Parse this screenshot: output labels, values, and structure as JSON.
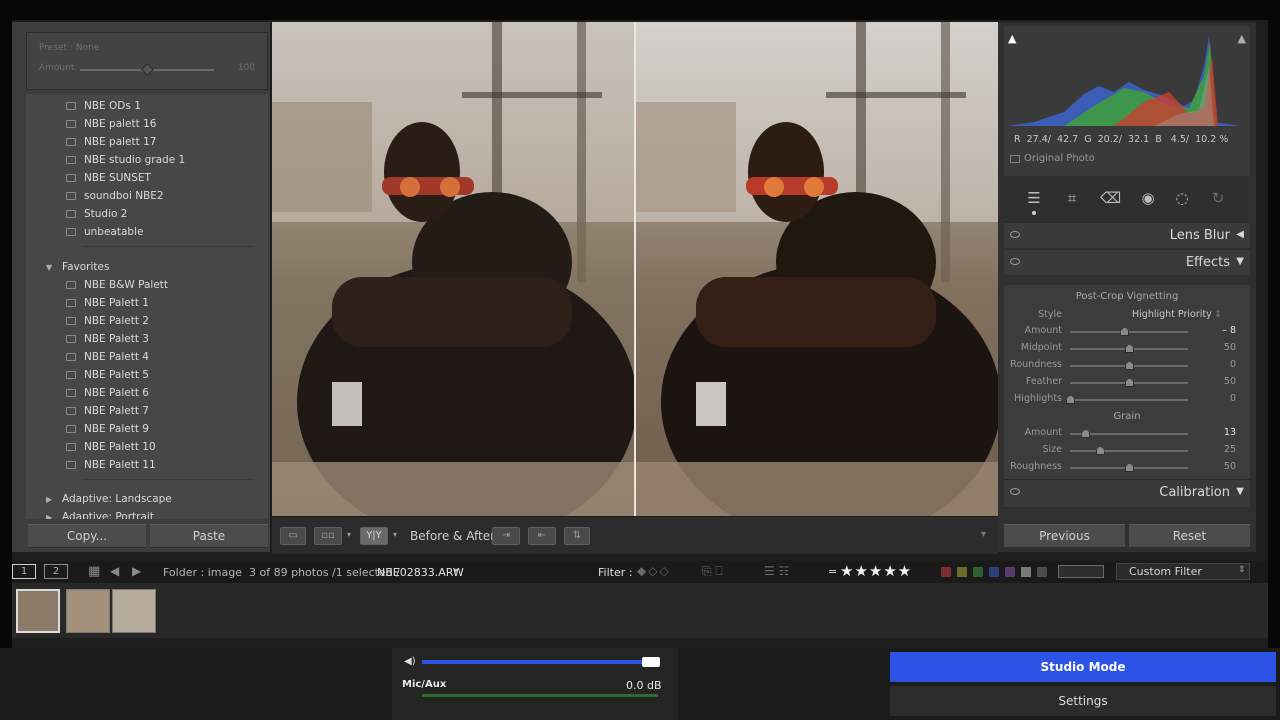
{
  "left_panel": {
    "preset_label": "Preset : None",
    "amount_label": "Amount",
    "amount_value": "100",
    "presets_top": [
      "NBE ODs 1",
      "NBE palett 16",
      "NBE palett 17",
      "NBE studio grade 1",
      "NBE SUNSET",
      "soundboi NBE2",
      "Studio 2",
      "unbeatable"
    ],
    "favorites_label": "Favorites",
    "favorites": [
      "NBE B&W Palett",
      "NBE Palett 1",
      "NBE Palett 2",
      "NBE Palett 3",
      "NBE Palett 4",
      "NBE Palett 5",
      "NBE Palett 6",
      "NBE Palett 7",
      "NBE Palett 9",
      "NBE Palett 10",
      "NBE Palett 11"
    ],
    "group_landscape": "Adaptive: Landscape",
    "group_portrait": "Adaptive: Portrait",
    "copy_btn": "Copy...",
    "paste_btn": "Paste"
  },
  "toolbar": {
    "before_after_label": "Before & After :",
    "view_yy": "Y|Y"
  },
  "right_panel": {
    "histogram": {
      "readout": "R  27.4/  42.7  G  20.2/  32.1  B   4.5/  10.2 %",
      "original_photo_label": "Original Photo"
    },
    "lens_blur_label": "Lens Blur",
    "effects_label": "Effects",
    "post_crop_label": "Post-Crop Vignetting",
    "style_label": "Style",
    "style_value": "Highlight Priority",
    "vignette_sliders": [
      {
        "name": "Amount",
        "value": "– 8",
        "level": 0.46,
        "highlight": true
      },
      {
        "name": "Midpoint",
        "value": "50",
        "level": 0.5,
        "highlight": false
      },
      {
        "name": "Roundness",
        "value": "0",
        "level": 0.5,
        "highlight": false
      },
      {
        "name": "Feather",
        "value": "50",
        "level": 0.5,
        "highlight": false
      },
      {
        "name": "Highlights",
        "value": "0",
        "level": 0.0,
        "highlight": false
      }
    ],
    "grain_label": "Grain",
    "grain_sliders": [
      {
        "name": "Amount",
        "value": "13",
        "level": 0.13,
        "highlight": true
      },
      {
        "name": "Size",
        "value": "25",
        "level": 0.25,
        "highlight": false
      },
      {
        "name": "Roughness",
        "value": "50",
        "level": 0.5,
        "highlight": false
      }
    ],
    "calibration_label": "Calibration",
    "previous_btn": "Previous",
    "reset_btn": "Reset"
  },
  "filmstrip_bar": {
    "page1": "1",
    "page2": "2",
    "folder": "Folder : image",
    "count_text": "3 of 89 photos /1 selected /",
    "filename": "NBE02833.ARW",
    "filter_label": "Filter :",
    "rating_prefix": "=",
    "stars": "★★★★★",
    "custom_filter": "Custom Filter"
  },
  "obs": {
    "mic_label": "Mic/Aux",
    "mic_db": "0.0 dB",
    "studio_mode": "Studio Mode",
    "settings": "Settings"
  },
  "colors": {
    "accent_blue": "#2c52e6",
    "panel_bg": "#3d3d3d",
    "center_bg": "#111111"
  }
}
